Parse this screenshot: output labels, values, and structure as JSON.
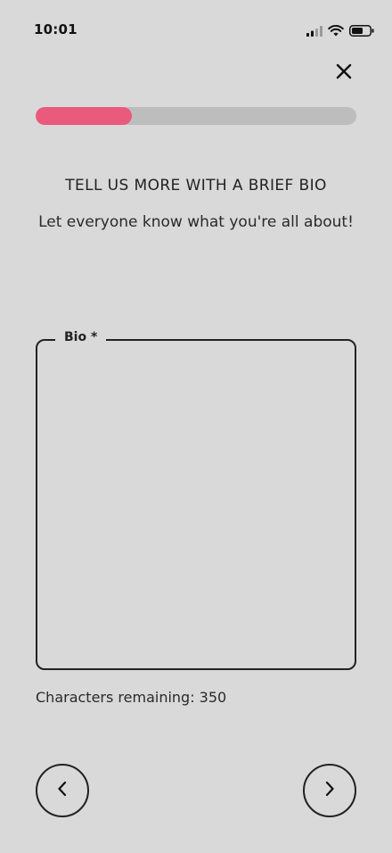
{
  "status_bar": {
    "time": "10:01",
    "icons": [
      "cellular-signal-icon",
      "wifi-icon",
      "battery-icon"
    ]
  },
  "header": {
    "close_icon": "close-icon"
  },
  "progress": {
    "fraction": 0.3,
    "fill_color": "#ea5a7d",
    "track_color": "#bdbdbd"
  },
  "content": {
    "title": "TELL US MORE WITH A BRIEF BIO",
    "subtitle": "Let everyone know what you're all about!"
  },
  "bio": {
    "label": "Bio *",
    "value": "",
    "chars_remaining_label": "Characters remaining: 350"
  },
  "navigation": {
    "back_icon": "chevron-left-icon",
    "next_icon": "chevron-right-icon"
  },
  "colors": {
    "background": "#d9d9d9",
    "accent": "#ea5a7d",
    "outline": "#222222"
  }
}
